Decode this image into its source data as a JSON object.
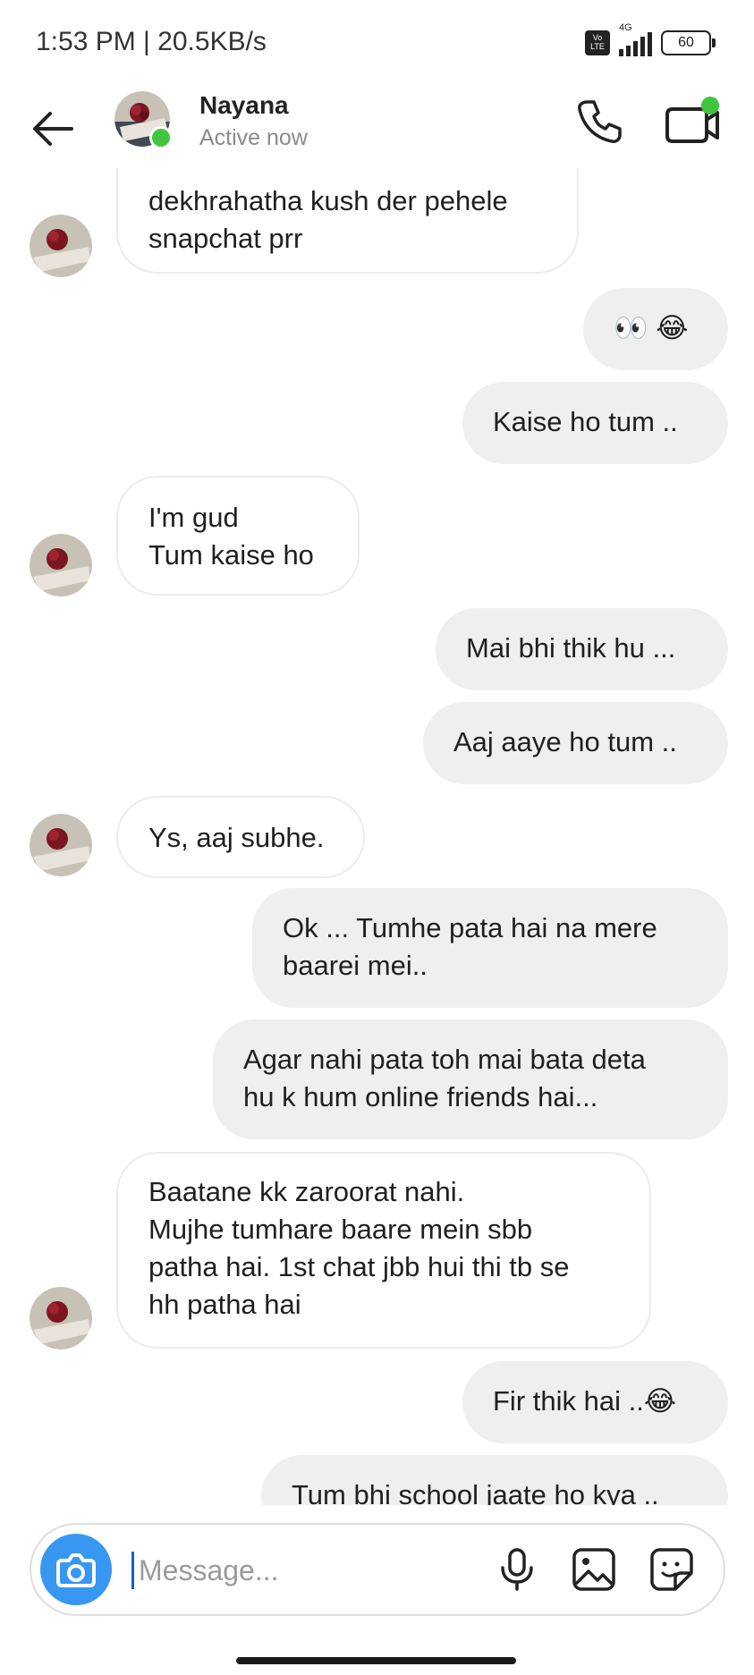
{
  "status_bar": {
    "time": "1:53 PM | 20.5KB/s",
    "network": "4G",
    "volte": "Vo LTE",
    "battery": "60"
  },
  "header": {
    "name": "Nayana",
    "status": "Active now",
    "online_color": "#3fc53f",
    "icons": [
      "back-arrow-icon",
      "phone-icon",
      "video-call-icon"
    ]
  },
  "messages": [
    {
      "side": "in",
      "text": "dekhrahatha kush der pehele\nsnapchat prr"
    },
    {
      "side": "out",
      "text": "👀 😂"
    },
    {
      "side": "out",
      "text": "Kaise ho tum .."
    },
    {
      "side": "in",
      "text": "I'm gud\nTum kaise ho"
    },
    {
      "side": "out",
      "text": "Mai bhi thik hu ..."
    },
    {
      "side": "out",
      "text": "Aaj aaye ho tum .."
    },
    {
      "side": "in",
      "text": "Ys, aaj subhe."
    },
    {
      "side": "out",
      "text": "Ok ... Tumhe pata hai na mere\nbaarei mei.."
    },
    {
      "side": "out",
      "text": "Agar nahi pata toh mai bata deta\nhu k hum online friends hai..."
    },
    {
      "side": "in",
      "text": "Baatane kk zaroorat nahi.\nMujhe tumhare baare mein sbb\npatha hai. 1st chat jbb hui thi tb se\nhh patha hai"
    },
    {
      "side": "out",
      "text": "Fir thik hai ..😂"
    },
    {
      "side": "out",
      "text": "Tum bhi school jaate ho kya .."
    }
  ],
  "composer": {
    "placeholder": "Message...",
    "accent": "#3897f0",
    "icons": [
      "camera-icon",
      "microphone-icon",
      "gallery-icon",
      "sticker-icon"
    ]
  }
}
